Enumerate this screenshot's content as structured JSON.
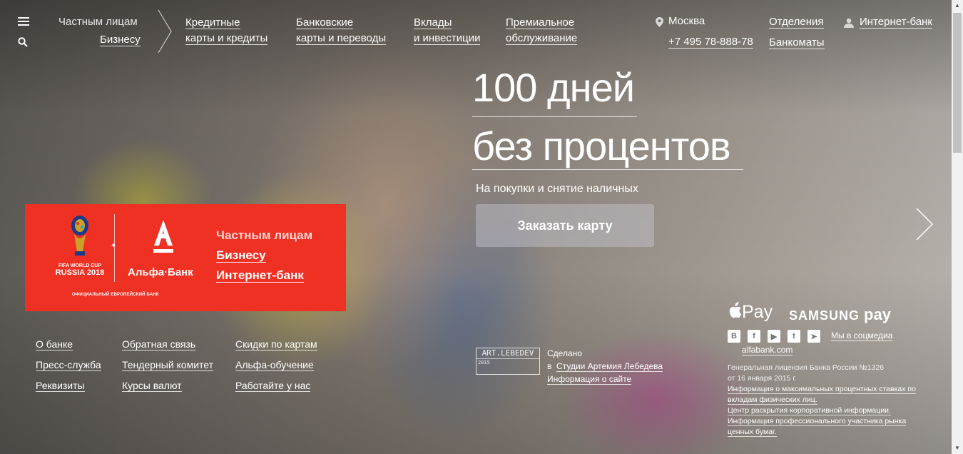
{
  "header": {
    "segments": [
      "Частным лицам",
      "Бизнесу"
    ],
    "nav": [
      {
        "line1": "Кредитные",
        "line2": "карты и кредиты"
      },
      {
        "line1": "Банковские",
        "line2": "карты и переводы"
      },
      {
        "line1": "Вклады",
        "line2": "и инвестиции"
      },
      {
        "line1": "Премиальное",
        "line2": "обслуживание"
      }
    ],
    "city": "Москва",
    "phone": "+7 495 78-888-78",
    "branches": "Отделения",
    "atms": "Банкоматы",
    "internet_bank": "Интернет-банк"
  },
  "hero": {
    "title_line1": "100 дней",
    "title_line2": "без процентов",
    "subtitle": "На покупки и снятие наличных",
    "cta": "Заказать карту"
  },
  "card": {
    "fifa_line1": "FIFA WORLD CUP",
    "fifa_line2": "RUSSIA 2018",
    "bank_name": "Альфа·Банк",
    "official": "ОФИЦИАЛЬНЫЙ ЕВРОПЕЙСКИЙ БАНК",
    "links": [
      "Частным лицам",
      "Бизнесу",
      "Интернет-банк"
    ]
  },
  "footer": {
    "col1": [
      "О банке",
      "Пресс-служба",
      "Реквизиты"
    ],
    "col2": [
      "Обратная связь",
      "Тендерный комитет",
      "Курсы валют"
    ],
    "col3": [
      "Скидки по картам",
      "Альфа-обучение",
      "Работайте у нас"
    ],
    "studio_logo": "ART.LEBEDEV",
    "studio_year": "2015",
    "made_label": "Сделано",
    "made_prefix": "в",
    "studio_link": "Студии Артемия Лебедева",
    "site_info": "Информация о сайте",
    "apple_pay": "Pay",
    "samsung_pay_1": "SAMSUNG",
    "samsung_pay_2": "pay",
    "social_label": "Мы в соцмедиа",
    "domain": "alfabank.com",
    "license_1": "Генеральная лицензия Банка России №1326",
    "license_2": "от 16 января 2015 г.",
    "legal_links": [
      "Информация о максимальных процентных ставках по вкладам физических лиц.",
      "Центр раскрытия корпоративной информации.",
      "Информация профессионального участника рынка ценных бумаг."
    ]
  },
  "icons": [
    "menu-icon",
    "search-icon",
    "location-pin-icon",
    "user-icon",
    "chevron-right-icon",
    "apple-icon",
    "vk-icon",
    "facebook-icon",
    "youtube-icon",
    "twitter-icon",
    "telegram-icon"
  ],
  "colors": {
    "brand_red": "#ef3124"
  }
}
